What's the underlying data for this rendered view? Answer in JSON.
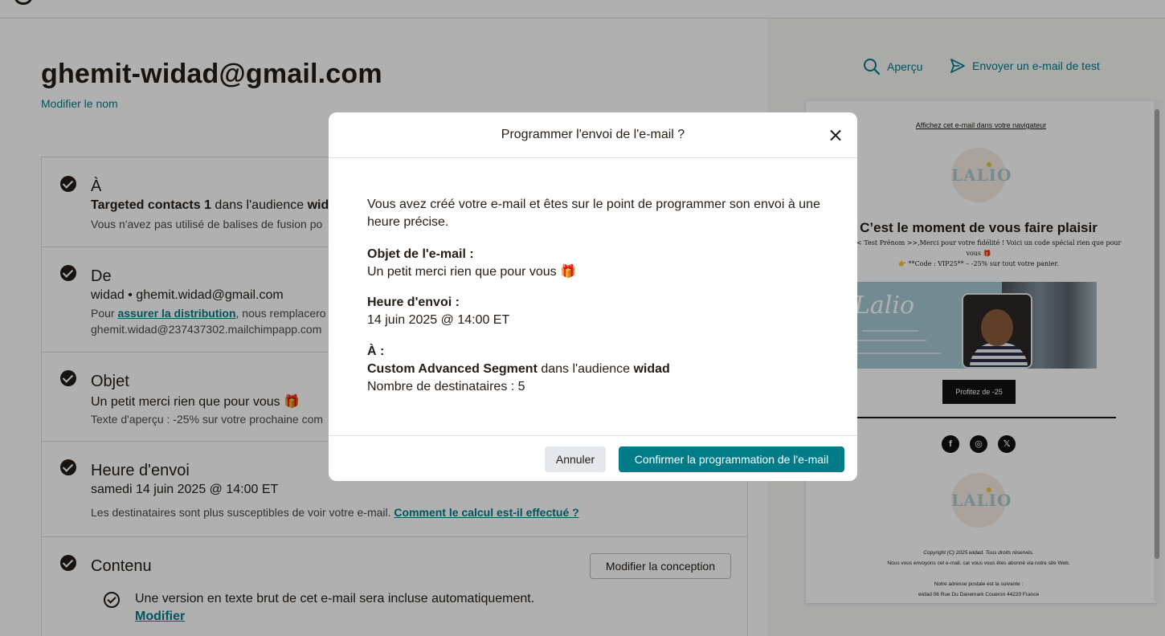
{
  "page": {
    "title": "ghemit-widad@gmail.com",
    "rename_link": "Modifier le nom"
  },
  "steps": {
    "to": {
      "title": "À",
      "line_bold": "Targeted contacts 1",
      "line_rest": " dans l'audience ",
      "line_bold2": "wid",
      "sub": "Vous n'avez pas utilisé de balises de fusion po"
    },
    "from": {
      "title": "De",
      "line": "widad  •  ghemit.widad@gmail.com",
      "sub_pre": "Pour ",
      "sub_link": "assurer la distribution",
      "sub_post": ", nous remplacero",
      "sub2": "ghemit.widad@237437302.mailchimpapp.com"
    },
    "subject": {
      "title": "Objet",
      "line": "Un petit merci rien que pour vous 🎁",
      "sub": "Texte d'aperçu : -25% sur votre prochaine com"
    },
    "send_time": {
      "title": "Heure d'envoi",
      "line": "samedi 14 juin 2025 @ 14:00 ET",
      "sub": "Les destinataires sont plus susceptibles de voir votre e-mail. ",
      "sub_link": "Comment le calcul est-il effectué ?"
    },
    "content": {
      "title": "Contenu",
      "edit_design_button": "Modifier la conception",
      "plain_text_note": "Une version en texte brut de cet e-mail sera incluse automatiquement.",
      "edit_link": "Modifier"
    }
  },
  "preview": {
    "preview_action": "Aperçu",
    "send_test_action": "Envoyer un e-mail de test",
    "email": {
      "view_in_browser": "Affichez cet e-mail dans votre navigateur",
      "logo_text": "LALIO",
      "headline": "C’est le moment de vous faire plaisir",
      "intro_line1": "jour << Test Prénom >>,Merci pour votre fidélité ! Voici un code spécial rien que pour",
      "intro_line2": "vous 🎁",
      "code_line": "👉 **Code : VIP25** – -25% sur tout votre panier.",
      "banner_brand": "Lalio",
      "cta": "Profitez de -25",
      "social": [
        "f",
        "◎",
        "𝕏"
      ],
      "copyright": "Copyright (C) 2025 widad. Tous droits réservés.",
      "reason": "Nous vous envoyons cet e-mail, car vous vous êtes abonné via notre site Web.",
      "address_label": "Notre adresse postale est la suivante :",
      "address": "widad 06 Rue Du Danemark Coueron 44220 France"
    }
  },
  "modal": {
    "title": "Programmer l'envoi de l'e-mail ?",
    "intro": "Vous avez créé votre e-mail et êtes sur le point de programmer son envoi à une heure précise.",
    "subject_label": "Objet de l'e-mail :",
    "subject_value": "Un petit merci rien que pour vous 🎁",
    "time_label": "Heure d'envoi :",
    "time_value": "14 juin 2025 @ 14:00 ET",
    "to_label": "À :",
    "segment": "Custom Advanced Segment",
    "audience_text": " dans l'audience ",
    "audience": "widad",
    "recipients": "Nombre de destinataires : 5",
    "cancel": "Annuler",
    "confirm": "Confirmer la programmation de l'e-mail"
  },
  "colors": {
    "accent": "#007c89",
    "text": "#241c15",
    "overlay": "rgba(0,0,0,0.31)"
  }
}
